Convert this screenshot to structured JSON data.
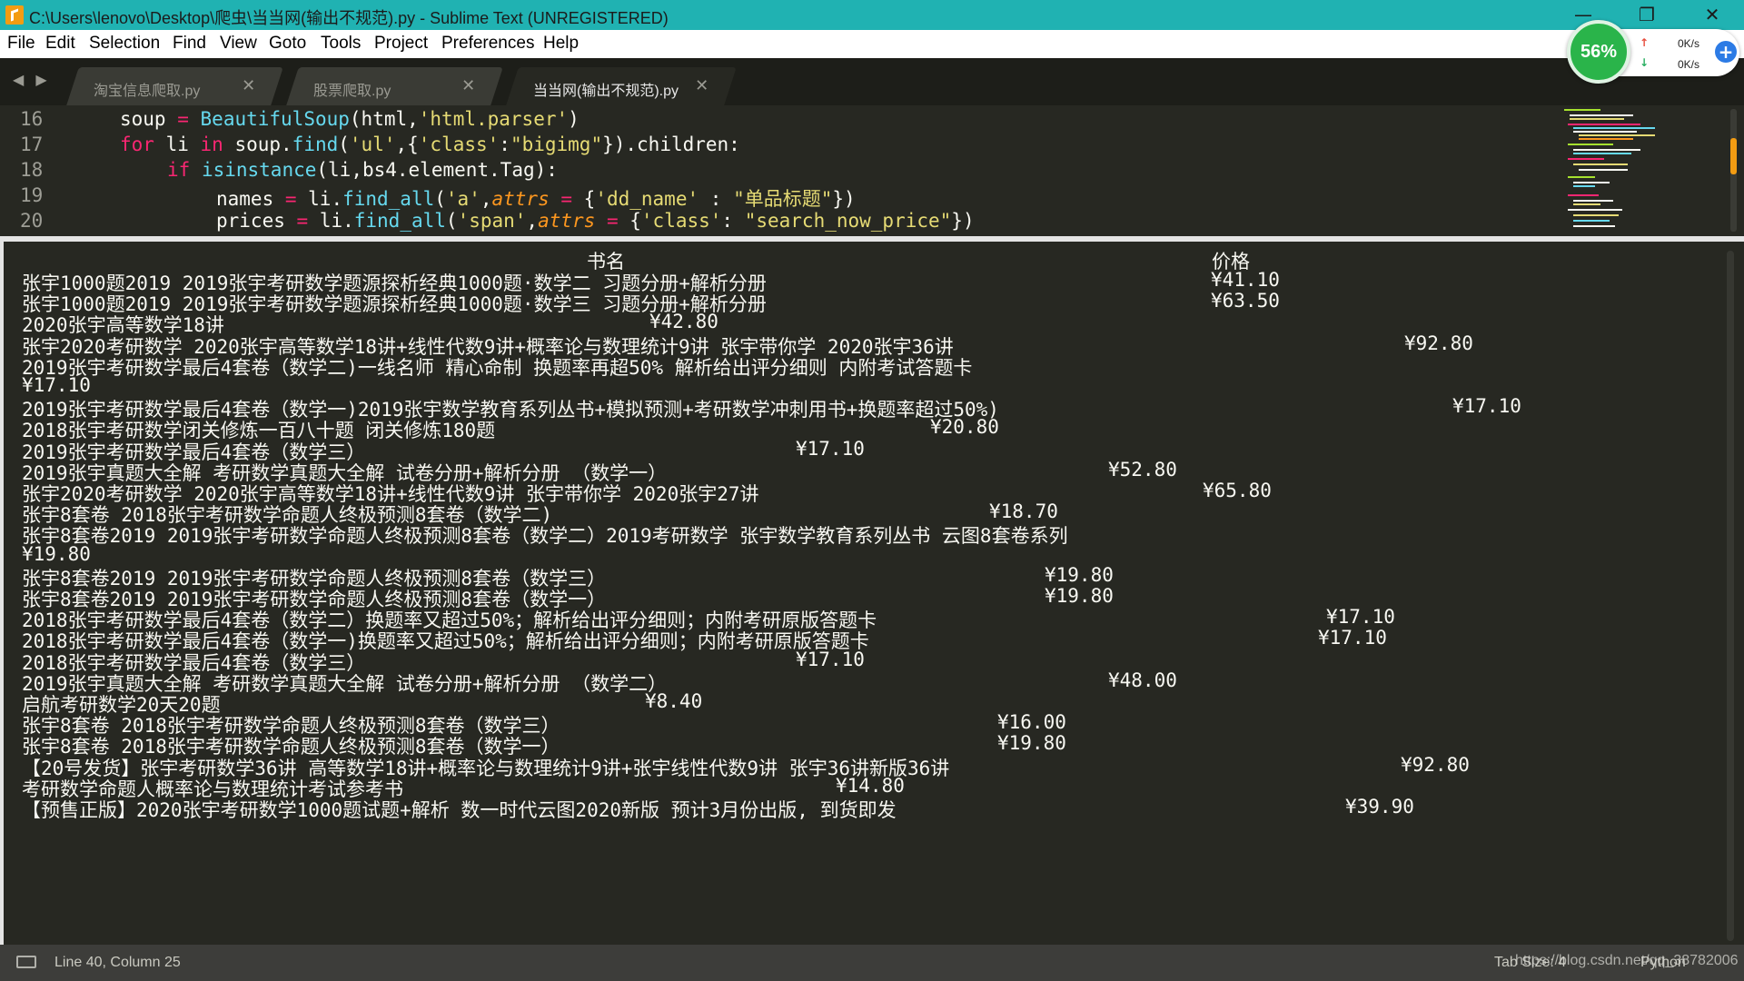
{
  "window": {
    "title": "C:\\Users\\lenovo\\Desktop\\爬虫\\当当网(输出不规范).py - Sublime Text (UNREGISTERED)",
    "controls": {
      "minimize": "—",
      "maximize": "❐",
      "close": "✕"
    }
  },
  "menu": {
    "items": [
      "File",
      "Edit",
      "Selection",
      "Find",
      "View",
      "Goto",
      "Tools",
      "Project",
      "Preferences",
      "Help"
    ]
  },
  "tabs": {
    "nav": "◀ ▶",
    "items": [
      {
        "label": "淘宝信息爬取.py",
        "close": "✕"
      },
      {
        "label": "股票爬取.py",
        "close": "✕"
      },
      {
        "label": "当当网(输出不规范).py",
        "close": "✕"
      }
    ],
    "active_index": 2
  },
  "speed_widget": {
    "percent": "56%",
    "upload": "0K/s",
    "download": "0K/s",
    "up_arrow": "↑",
    "down_arrow": "↓",
    "plus": "+"
  },
  "editor": {
    "line_numbers": [
      "16",
      "17",
      "18",
      "19",
      "20"
    ],
    "lines": [
      [
        [
          "soup ",
          ""
        ],
        [
          "=",
          "kw"
        ],
        [
          " ",
          ""
        ],
        [
          "BeautifulSoup",
          "fn"
        ],
        [
          "(html,",
          ""
        ],
        [
          "'html.parser'",
          "str"
        ],
        [
          ")",
          ""
        ]
      ],
      [
        [
          "for",
          "kw"
        ],
        [
          " li ",
          ""
        ],
        [
          "in",
          "kw"
        ],
        [
          " soup.",
          ""
        ],
        [
          "find",
          "fn"
        ],
        [
          "(",
          ""
        ],
        [
          "'ul'",
          "str"
        ],
        [
          ",{",
          ""
        ],
        [
          "'class'",
          "str"
        ],
        [
          ":",
          ""
        ],
        [
          "\"bigimg\"",
          "str"
        ],
        [
          "}).children:",
          ""
        ]
      ],
      [
        [
          "if",
          "kw"
        ],
        [
          " ",
          ""
        ],
        [
          "isinstance",
          "fn"
        ],
        [
          "(li,bs4.element.Tag):",
          ""
        ]
      ],
      [
        [
          "names ",
          ""
        ],
        [
          "=",
          "kw"
        ],
        [
          " li.",
          ""
        ],
        [
          "find_all",
          "fn"
        ],
        [
          "(",
          ""
        ],
        [
          "'a'",
          "str"
        ],
        [
          ",",
          ""
        ],
        [
          "attrs",
          "var"
        ],
        [
          " ",
          ""
        ],
        [
          "=",
          "kw"
        ],
        [
          " {",
          ""
        ],
        [
          "'dd_name'",
          "str"
        ],
        [
          " : ",
          ""
        ],
        [
          "\"单品标题\"",
          "str"
        ],
        [
          "})",
          ""
        ]
      ],
      [
        [
          "prices ",
          ""
        ],
        [
          "=",
          "kw"
        ],
        [
          " li.",
          ""
        ],
        [
          "find_all",
          "fn"
        ],
        [
          "(",
          ""
        ],
        [
          "'span'",
          "str"
        ],
        [
          ",",
          ""
        ],
        [
          "attrs",
          "var"
        ],
        [
          " ",
          ""
        ],
        [
          "=",
          "kw"
        ],
        [
          " {",
          ""
        ],
        [
          "'class'",
          "str"
        ],
        [
          ": ",
          ""
        ],
        [
          "\"search_now_price\"",
          "str"
        ],
        [
          "})",
          ""
        ]
      ]
    ]
  },
  "console": {
    "header": {
      "col1": "书名",
      "col2": "价格"
    },
    "rows": [
      {
        "title": "张宇1000题2019 2019张宇考研数学题源探析经典1000题·数学二 习题分册+解析分册",
        "price": "¥41.10"
      },
      {
        "title": "张宇1000题2019 2019张宇考研数学题源探析经典1000题·数学三 习题分册+解析分册",
        "price": "¥63.50"
      },
      {
        "title": "2020张宇高等数学18讲",
        "price": "¥42.80"
      },
      {
        "title": "张宇2020考研数学 2020张宇高等数学18讲+线性代数9讲+概率论与数理统计9讲 张宇带你学 2020张宇36讲",
        "price": "¥92.80"
      },
      {
        "title": "2019张宇考研数学最后4套卷（数学二)一线名师 精心命制 换题率再超50% 解析给出评分细则 内附考试答题卡",
        "price": ""
      },
      {
        "title": "¥17.10",
        "price": ""
      },
      {
        "title": "2019张宇考研数学最后4套卷（数学一)2019张宇数学教育系列丛书+模拟预测+考研数学冲刺用书+换题率超过50%)",
        "price": "¥17.10"
      },
      {
        "title": "2018张宇考研数学闭关修炼一百八十题 闭关修炼180题",
        "price": "¥20.80"
      },
      {
        "title": "2019张宇考研数学最后4套卷（数学三）",
        "price": "¥17.10"
      },
      {
        "title": "2019张宇真题大全解 考研数学真题大全解 试卷分册+解析分册 （数学一）",
        "price": "¥52.80"
      },
      {
        "title": "张宇2020考研数学 2020张宇高等数学18讲+线性代数9讲 张宇带你学 2020张宇27讲",
        "price": "¥65.80"
      },
      {
        "title": "张宇8套卷 2018张宇考研数学命题人终极预测8套卷（数学二)",
        "price": "¥18.70"
      },
      {
        "title": "张宇8套卷2019 2019张宇考研数学命题人终极预测8套卷（数学二）2019考研数学 张宇数学教育系列丛书 云图8套卷系列",
        "price": ""
      },
      {
        "title": "¥19.80",
        "price": ""
      },
      {
        "title": "张宇8套卷2019 2019张宇考研数学命题人终极预测8套卷（数学三）",
        "price": "¥19.80"
      },
      {
        "title": "张宇8套卷2019 2019张宇考研数学命题人终极预测8套卷（数学一）",
        "price": "¥19.80"
      },
      {
        "title": "2018张宇考研数学最后4套卷（数学二）换题率又超过50%；解析给出评分细则；内附考研原版答题卡",
        "price": "¥17.10"
      },
      {
        "title": "2018张宇考研数学最后4套卷（数学一)换题率又超过50%；解析给出评分细则；内附考研原版答题卡",
        "price": "¥17.10"
      },
      {
        "title": "2018张宇考研数学最后4套卷（数学三）",
        "price": "¥17.10"
      },
      {
        "title": "2019张宇真题大全解 考研数学真题大全解 试卷分册+解析分册 （数学二）",
        "price": "¥48.00"
      },
      {
        "title": "启航考研数学20天20题",
        "price": "¥8.40"
      },
      {
        "title": "张宇8套卷 2018张宇考研数学命题人终极预测8套卷（数学三）",
        "price": "¥16.00"
      },
      {
        "title": "张宇8套卷 2018张宇考研数学命题人终极预测8套卷（数学一）",
        "price": "¥19.80"
      },
      {
        "title": "【20号发货】张宇考研数学36讲 高等数学18讲+概率论与数理统计9讲+张宇线性代数9讲 张宇36讲新版36讲",
        "price": "¥92.80"
      },
      {
        "title": "考研数学命题人概率论与数理统计考试参考书",
        "price": "¥14.80"
      },
      {
        "title": "【预售正版】2020张宇考研数学1000题试题+解析 数一时代云图2020新版 预计3月份出版, 到货即发",
        "price": "¥39.90"
      }
    ]
  },
  "status": {
    "position": "Line 40, Column 25",
    "tab_size": "Tab Size: 4",
    "syntax": "Python",
    "watermark": "https://blog.csdn.net/qq_38782006"
  }
}
